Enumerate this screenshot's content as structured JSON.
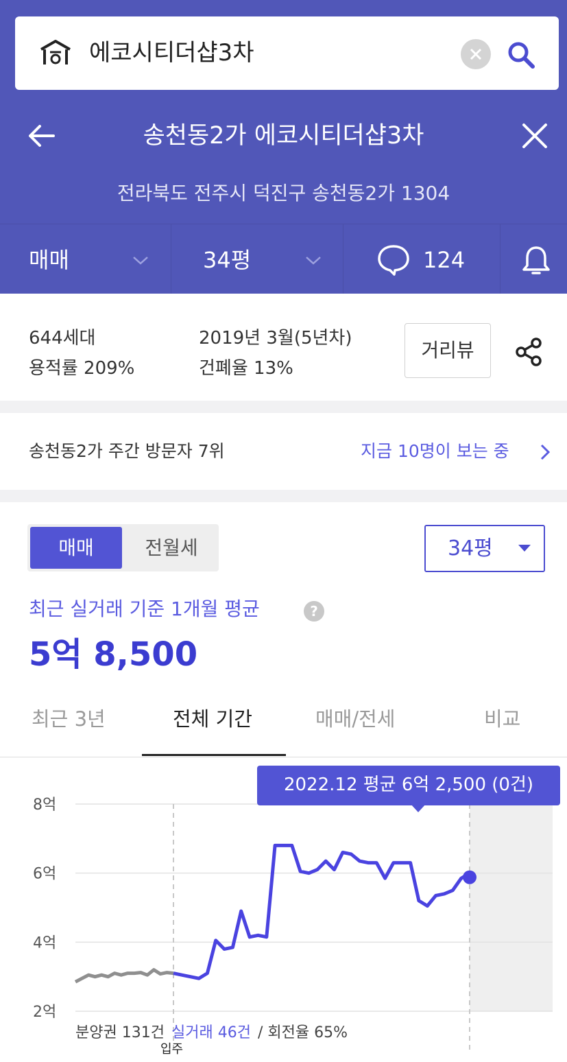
{
  "search": {
    "query": "에코시티더샵3차",
    "icon": "apartment-home-icon"
  },
  "header": {
    "title": "송천동2가 에코시티더샵3차",
    "address": "전라북도 전주시 덕진구 송천동2가 1304"
  },
  "filters": {
    "trade_type": "매매",
    "size": "34평",
    "comment_count": "124"
  },
  "info": {
    "households": "644세대",
    "built": "2019년 3월(5년차)",
    "floor_area_ratio": "용적률 209%",
    "building_coverage": "건폐율 13%",
    "street_view_button": "거리뷰"
  },
  "visitors": {
    "rank_text": "송천동2가 주간 방문자 7위",
    "now_viewing": "지금 10명이 보는 중"
  },
  "price": {
    "seg_on": "매매",
    "seg_off": "전월세",
    "size_select": "34평",
    "avg_label": "최근 실거래 기준 1개월 평균",
    "avg_value": "5억 8,500"
  },
  "tabs": [
    "최근 3년",
    "전체 기간",
    "매매/전세",
    "비교"
  ],
  "tooltip": "2022.12 평균 6억 2,500 (0건)",
  "chart_data": {
    "type": "line",
    "title": "",
    "xlabel": "",
    "ylabel": "",
    "ylim": [
      2,
      8
    ],
    "yticks": [
      "2억",
      "4억",
      "6억",
      "8억"
    ],
    "grid": true,
    "marker_label": "입주",
    "footer": {
      "presale": "분양권 131건",
      "actual": "실거래 46건",
      "turnover": " / 회전율 65%"
    },
    "series": [
      {
        "values": [
          2.85,
          2.95,
          3.05,
          3.0,
          3.05,
          3.0,
          3.1,
          3.05,
          3.1,
          3.1,
          3.12,
          3.05,
          3.2,
          3.08,
          3.12,
          3.1
        ]
      },
      {
        "values": [
          3.1,
          3.05,
          3.0,
          2.95,
          3.1,
          4.05,
          3.8,
          3.85,
          4.9,
          4.15,
          4.2,
          4.15,
          6.8,
          6.8,
          6.8,
          6.05,
          6.0,
          6.1,
          6.35,
          6.1,
          6.6,
          6.55,
          6.35,
          6.3,
          6.3,
          5.85,
          6.3,
          6.3,
          6.3,
          5.2,
          5.05,
          5.35,
          5.4,
          5.5,
          5.85,
          6.0
        ]
      }
    ],
    "highlight": {
      "label": "2022.12",
      "value": 5.88
    }
  }
}
